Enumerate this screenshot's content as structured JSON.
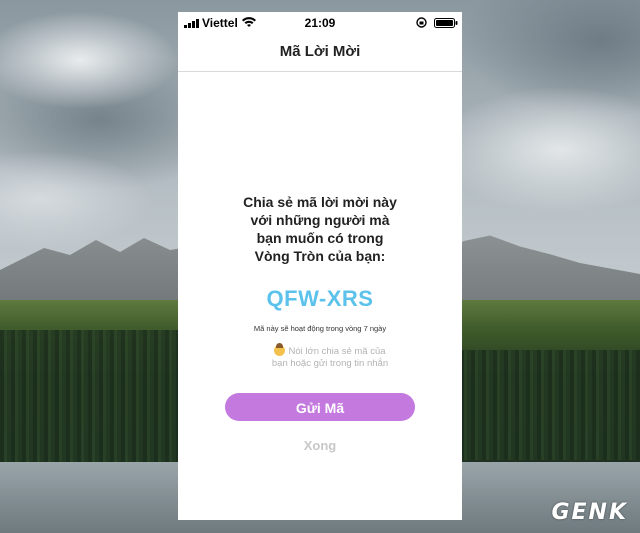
{
  "status_bar": {
    "carrier": "Viettel",
    "time": "21:09"
  },
  "nav": {
    "title": "Mã Lời Mời"
  },
  "invite": {
    "message_lines": [
      "Chia sẻ mã lời mời này",
      "với những người mà",
      "bạn muốn có trong",
      "Vòng Tròn của bạn:"
    ],
    "code": "QFW-XRS",
    "expiry_note": "Mã này sẽ hoạt động trong vòng 7 ngày",
    "hint_lines": [
      "Nói lớn chia sẻ mã của",
      "bạn hoặc gửi trong tin nhắn"
    ]
  },
  "actions": {
    "send_label": "Gửi Mã",
    "done_label": "Xong"
  },
  "watermark": "GENK",
  "colors": {
    "code": "#5cc2ec",
    "send_button": "#c479de",
    "done_text": "#c8c8c8",
    "hint_text": "#b3b3b3"
  },
  "icons": [
    "signal-icon",
    "wifi-icon",
    "rotation-lock-icon",
    "battery-icon",
    "woman-raising-hand-emoji"
  ]
}
